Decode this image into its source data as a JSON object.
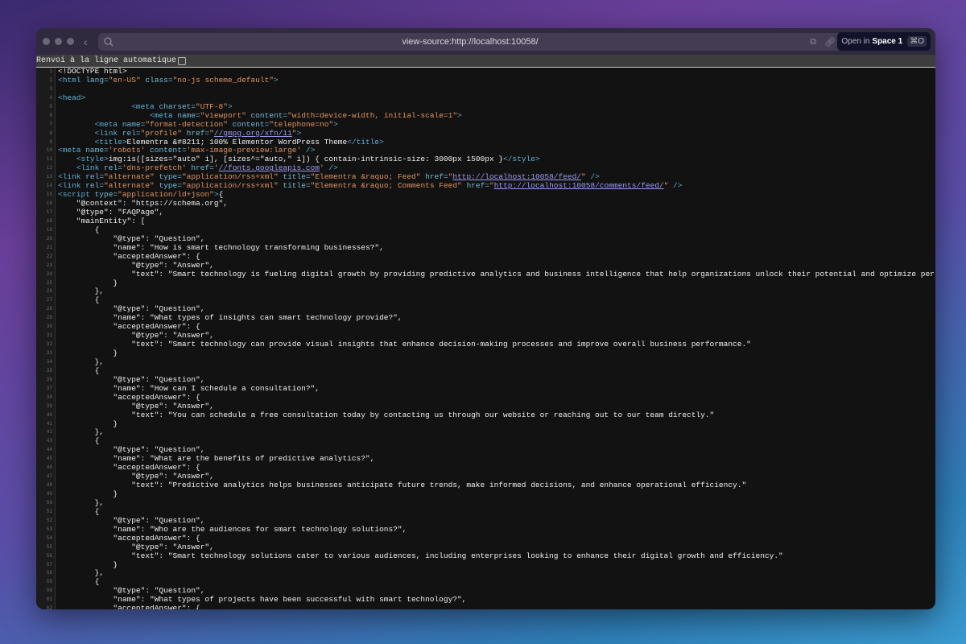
{
  "browser": {
    "url": "view-source:http://localhost:10058/",
    "open_in_label": "Open in",
    "space_label": "Space 1",
    "shortcut": "⌘O",
    "wrap_label": "Renvoi à la ligne automatique",
    "wrap_checked": false
  },
  "colors": {
    "tag": "#5cb0d6",
    "value": "#e0935f",
    "link": "#9c9cf2",
    "text": "#f0f0f0",
    "background": "#121212"
  },
  "lines": [
    [
      [
        "x",
        "<!DOCTYPE html>"
      ]
    ],
    [
      [
        "t",
        "<html "
      ],
      [
        "a",
        "lang="
      ],
      [
        "v",
        "\"en-US\""
      ],
      [
        "a",
        " class="
      ],
      [
        "v",
        "\"no-js scheme_default\""
      ],
      [
        "t",
        ">"
      ]
    ],
    [],
    [
      [
        "t",
        "<head>"
      ]
    ],
    [
      [
        "x",
        "                "
      ],
      [
        "t",
        "<meta "
      ],
      [
        "a",
        "charset="
      ],
      [
        "v",
        "\"UTF-8\""
      ],
      [
        "t",
        ">"
      ]
    ],
    [
      [
        "x",
        "                    "
      ],
      [
        "t",
        "<meta "
      ],
      [
        "a",
        "name="
      ],
      [
        "v",
        "\"viewport\""
      ],
      [
        "a",
        " content="
      ],
      [
        "v",
        "\"width=device-width, initial-scale=1\""
      ],
      [
        "t",
        ">"
      ]
    ],
    [
      [
        "x",
        "        "
      ],
      [
        "t",
        "<meta "
      ],
      [
        "a",
        "name="
      ],
      [
        "v",
        "\"format-detection\""
      ],
      [
        "a",
        " content="
      ],
      [
        "v",
        "\"telephone=no\""
      ],
      [
        "t",
        ">"
      ]
    ],
    [
      [
        "x",
        "        "
      ],
      [
        "t",
        "<link "
      ],
      [
        "a",
        "rel="
      ],
      [
        "v",
        "\"profile\""
      ],
      [
        "a",
        " href="
      ],
      [
        "v",
        "\""
      ],
      [
        "u",
        "//gmpg.org/xfn/11"
      ],
      [
        "v",
        "\""
      ],
      [
        "t",
        ">"
      ]
    ],
    [
      [
        "x",
        "        "
      ],
      [
        "t",
        "<title>"
      ],
      [
        "x",
        "Elementra &#8211; 100% Elementor WordPress Theme"
      ],
      [
        "t",
        "</title>"
      ]
    ],
    [
      [
        "t",
        "<meta "
      ],
      [
        "a",
        "name="
      ],
      [
        "v",
        "'robots'"
      ],
      [
        "a",
        " content="
      ],
      [
        "v",
        "'max-image-preview:large'"
      ],
      [
        "t",
        " />"
      ]
    ],
    [
      [
        "x",
        "    "
      ],
      [
        "t",
        "<style>"
      ],
      [
        "x",
        "img:is([sizes=\"auto\" i], [sizes^=\"auto,\" i]) { contain-intrinsic-size: 3000px 1500px }"
      ],
      [
        "t",
        "</style>"
      ]
    ],
    [
      [
        "x",
        "    "
      ],
      [
        "t",
        "<link "
      ],
      [
        "a",
        "rel="
      ],
      [
        "v",
        "'dns-prefetch'"
      ],
      [
        "a",
        " href="
      ],
      [
        "v",
        "'"
      ],
      [
        "u",
        "//fonts.googleapis.com"
      ],
      [
        "v",
        "'"
      ],
      [
        "t",
        " />"
      ]
    ],
    [
      [
        "t",
        "<link "
      ],
      [
        "a",
        "rel="
      ],
      [
        "v",
        "\"alternate\""
      ],
      [
        "a",
        " type="
      ],
      [
        "v",
        "\"application/rss+xml\""
      ],
      [
        "a",
        " title="
      ],
      [
        "v",
        "\"Elementra &raquo; Feed\""
      ],
      [
        "a",
        " href="
      ],
      [
        "v",
        "\""
      ],
      [
        "u",
        "http://localhost:10058/feed/"
      ],
      [
        "v",
        "\""
      ],
      [
        "t",
        " />"
      ]
    ],
    [
      [
        "t",
        "<link "
      ],
      [
        "a",
        "rel="
      ],
      [
        "v",
        "\"alternate\""
      ],
      [
        "a",
        " type="
      ],
      [
        "v",
        "\"application/rss+xml\""
      ],
      [
        "a",
        " title="
      ],
      [
        "v",
        "\"Elementra &raquo; Comments Feed\""
      ],
      [
        "a",
        " href="
      ],
      [
        "v",
        "\""
      ],
      [
        "u",
        "http://localhost:10058/comments/feed/"
      ],
      [
        "v",
        "\""
      ],
      [
        "t",
        " />"
      ]
    ],
    [
      [
        "t",
        "<script "
      ],
      [
        "a",
        "type="
      ],
      [
        "v",
        "\"application/ld+json\""
      ],
      [
        "t",
        ">"
      ],
      [
        "x",
        "{"
      ]
    ],
    [
      [
        "x",
        "    \"@context\": \"https://schema.org\","
      ]
    ],
    [
      [
        "x",
        "    \"@type\": \"FAQPage\","
      ]
    ],
    [
      [
        "x",
        "    \"mainEntity\": ["
      ]
    ],
    [
      [
        "x",
        "        {"
      ]
    ],
    [
      [
        "x",
        "            \"@type\": \"Question\","
      ]
    ],
    [
      [
        "x",
        "            \"name\": \"How is smart technology transforming businesses?\","
      ]
    ],
    [
      [
        "x",
        "            \"acceptedAnswer\": {"
      ]
    ],
    [
      [
        "x",
        "                \"@type\": \"Answer\","
      ]
    ],
    [
      [
        "x",
        "                \"text\": \"Smart technology is fueling digital growth by providing predictive analytics and business intelligence that help organizations unlock their potential and optimize per"
      ]
    ],
    [
      [
        "x",
        "            }"
      ]
    ],
    [
      [
        "x",
        "        },"
      ]
    ],
    [
      [
        "x",
        "        {"
      ]
    ],
    [
      [
        "x",
        "            \"@type\": \"Question\","
      ]
    ],
    [
      [
        "x",
        "            \"name\": \"What types of insights can smart technology provide?\","
      ]
    ],
    [
      [
        "x",
        "            \"acceptedAnswer\": {"
      ]
    ],
    [
      [
        "x",
        "                \"@type\": \"Answer\","
      ]
    ],
    [
      [
        "x",
        "                \"text\": \"Smart technology can provide visual insights that enhance decision-making processes and improve overall business performance.\""
      ]
    ],
    [
      [
        "x",
        "            }"
      ]
    ],
    [
      [
        "x",
        "        },"
      ]
    ],
    [
      [
        "x",
        "        {"
      ]
    ],
    [
      [
        "x",
        "            \"@type\": \"Question\","
      ]
    ],
    [
      [
        "x",
        "            \"name\": \"How can I schedule a consultation?\","
      ]
    ],
    [
      [
        "x",
        "            \"acceptedAnswer\": {"
      ]
    ],
    [
      [
        "x",
        "                \"@type\": \"Answer\","
      ]
    ],
    [
      [
        "x",
        "                \"text\": \"You can schedule a free consultation today by contacting us through our website or reaching out to our team directly.\""
      ]
    ],
    [
      [
        "x",
        "            }"
      ]
    ],
    [
      [
        "x",
        "        },"
      ]
    ],
    [
      [
        "x",
        "        {"
      ]
    ],
    [
      [
        "x",
        "            \"@type\": \"Question\","
      ]
    ],
    [
      [
        "x",
        "            \"name\": \"What are the benefits of predictive analytics?\","
      ]
    ],
    [
      [
        "x",
        "            \"acceptedAnswer\": {"
      ]
    ],
    [
      [
        "x",
        "                \"@type\": \"Answer\","
      ]
    ],
    [
      [
        "x",
        "                \"text\": \"Predictive analytics helps businesses anticipate future trends, make informed decisions, and enhance operational efficiency.\""
      ]
    ],
    [
      [
        "x",
        "            }"
      ]
    ],
    [
      [
        "x",
        "        },"
      ]
    ],
    [
      [
        "x",
        "        {"
      ]
    ],
    [
      [
        "x",
        "            \"@type\": \"Question\","
      ]
    ],
    [
      [
        "x",
        "            \"name\": \"Who are the audiences for smart technology solutions?\","
      ]
    ],
    [
      [
        "x",
        "            \"acceptedAnswer\": {"
      ]
    ],
    [
      [
        "x",
        "                \"@type\": \"Answer\","
      ]
    ],
    [
      [
        "x",
        "                \"text\": \"Smart technology solutions cater to various audiences, including enterprises looking to enhance their digital growth and efficiency.\""
      ]
    ],
    [
      [
        "x",
        "            }"
      ]
    ],
    [
      [
        "x",
        "        },"
      ]
    ],
    [
      [
        "x",
        "        {"
      ]
    ],
    [
      [
        "x",
        "            \"@type\": \"Question\","
      ]
    ],
    [
      [
        "x",
        "            \"name\": \"What types of projects have been successful with smart technology?\","
      ]
    ],
    [
      [
        "x",
        "            \"acceptedAnswer\": {"
      ]
    ]
  ]
}
